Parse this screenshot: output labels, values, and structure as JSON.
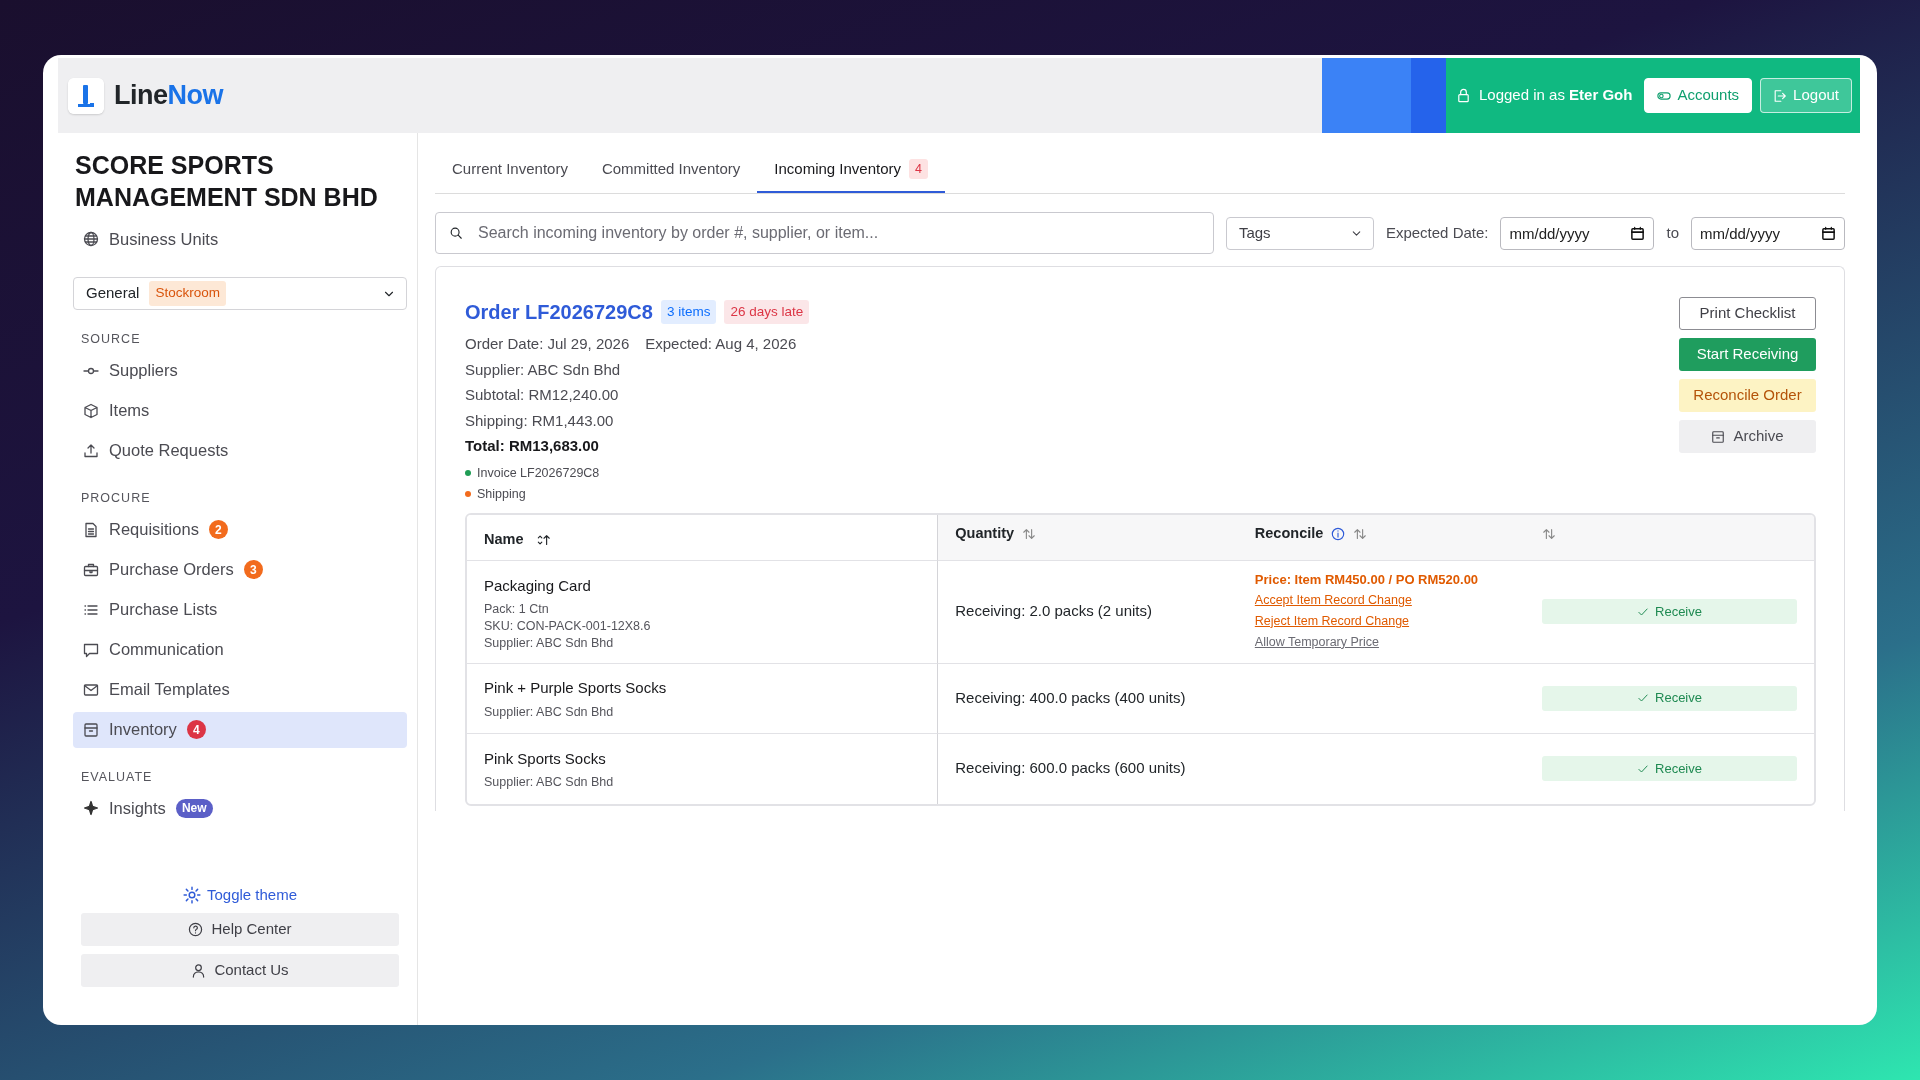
{
  "header": {
    "brand": [
      "Line",
      "Now"
    ],
    "user_text": "Logged in as **Eter Goh**",
    "buttons": [
      {
        "label": "Accounts",
        "kind": "light"
      },
      {
        "label": "Logout",
        "kind": "outline"
      }
    ]
  },
  "sidebar": {
    "company": "SCORE SPORTS MANAGEMENT SDN BHD",
    "business_units": "Business Units",
    "unit_select": {
      "value": "General",
      "tag": "Stockroom"
    },
    "sections": [
      {
        "heading": "SOURCE",
        "items": [
          {
            "label": "Suppliers",
            "selected": false
          },
          {
            "label": "Items",
            "selected": false
          },
          {
            "label": "Quote Requests",
            "selected": false
          }
        ]
      },
      {
        "heading": "PROCURE",
        "items": [
          {
            "label": "Requisitions",
            "selected": false,
            "badge": {
              "text": "2",
              "color": "#f26b1d"
            }
          },
          {
            "label": "Purchase Orders",
            "selected": false,
            "badge": {
              "text": "3",
              "color": "#f26b1d"
            }
          },
          {
            "label": "Purchase Lists",
            "selected": false
          },
          {
            "label": "Communication",
            "selected": false
          },
          {
            "label": "Email Templates",
            "selected": false
          },
          {
            "label": "Inventory",
            "selected": true,
            "badge": {
              "text": "4",
              "color": "#dc3545"
            }
          }
        ]
      },
      {
        "heading": "EVALUATE",
        "items": [
          {
            "label": "Insights",
            "selected": false,
            "badge": {
              "text": "New",
              "color": "#5b5fc7"
            }
          }
        ]
      }
    ],
    "toggle_theme": "Toggle theme",
    "buttons": [
      "Help Center",
      "Contact Us"
    ]
  },
  "tabs": [
    {
      "label": "Current Inventory",
      "selected": false
    },
    {
      "label": "Committed Inventory",
      "selected": false
    },
    {
      "label": "Incoming Inventory",
      "selected": true,
      "badge": "4"
    }
  ],
  "filters": {
    "search": {
      "placeholder": "Search incoming inventory by order #, supplier, or item..."
    },
    "tags": "Tags",
    "date_label": "Expected Date:",
    "date_from": {
      "placeholder": "mm/dd/yyyy"
    },
    "to": "to",
    "date_to": {
      "placeholder": "mm/dd/yyyy"
    }
  },
  "order": {
    "title": "Order LF2026729C8",
    "badges": [
      {
        "text": "3 items",
        "color": "#0d6efd"
      },
      {
        "text": "26 days late",
        "color": "#dc3545"
      }
    ],
    "dates": [
      "Order Date: Jul 29, 2026",
      "Expected: Aug 4, 2026"
    ],
    "details": [
      "Supplier: ABC Sdn Bhd",
      "Subtotal: RM12,240.00",
      "Shipping: RM1,443.00"
    ],
    "total": "Total: RM13,683.00",
    "statuses": [
      {
        "label": "Invoice",
        "value": "LF2026729C8",
        "color": "#1f9d55"
      },
      {
        "label": "Shipping",
        "color": "#f26b1d"
      }
    ],
    "actions": [
      {
        "label": "Print Checklist",
        "kind": "outline"
      },
      {
        "label": "Start Receiving",
        "kind": "success"
      },
      {
        "label": "Reconcile Order",
        "kind": "warning"
      },
      {
        "label": "Archive",
        "kind": "secondary"
      }
    ]
  },
  "table": {
    "columns": [
      {
        "label": "Name",
        "sorted": true
      },
      {
        "label": "Quantity",
        "sorted": false
      },
      {
        "label": "Reconcile",
        "sorted": false,
        "info": true
      },
      {
        "sorted": false
      }
    ],
    "rows": [
      {
        "name": "Packaging Card",
        "details": [
          "Pack: 1 Ctn",
          "SKU: CON-PACK-001-12X8.6",
          "Supplier: ABC Sdn Bhd"
        ],
        "quantity": "Receiving: 2.0 packs (2 units)",
        "reconcile": {
          "price": "Price: Item RM450.00 / PO RM520.00",
          "links": [
            {
              "label": "Accept Item Record Change",
              "kind": "warn"
            },
            {
              "label": "Reject Item Record Change",
              "kind": "warn"
            },
            {
              "label": "Allow Temporary Price",
              "kind": "muted"
            }
          ]
        },
        "action": "Receive"
      },
      {
        "name": "Pink + Purple Sports Socks",
        "details": [
          "Supplier: ABC Sdn Bhd"
        ],
        "quantity": "Receiving: 400.0 packs (400 units)",
        "action": "Receive"
      },
      {
        "name": "Pink Sports Socks",
        "details": [
          "Supplier: ABC Sdn Bhd"
        ],
        "quantity": "Receiving: 600.0 packs (600 units)",
        "action": "Receive"
      }
    ]
  }
}
